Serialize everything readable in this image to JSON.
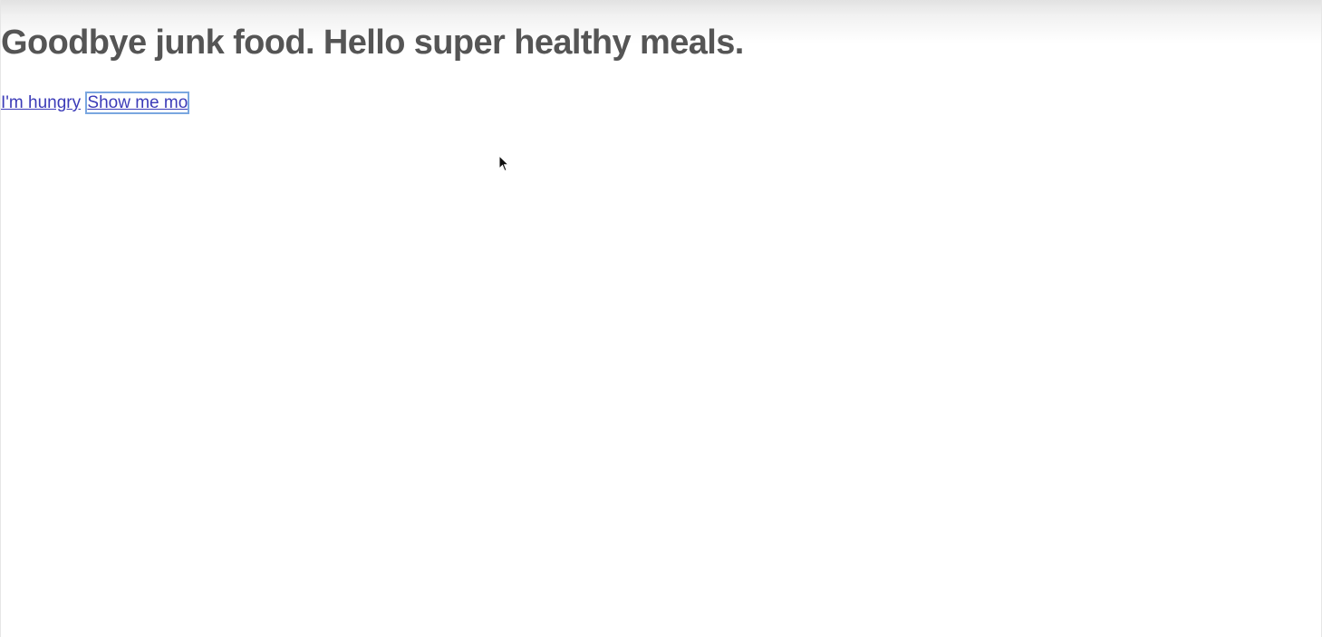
{
  "header": {
    "title": "Goodbye junk food. Hello super healthy meals."
  },
  "actions": {
    "hungry_label": "I'm hungry",
    "show_more_label": "Show me mo"
  },
  "cursor": {
    "icon": "arrow-cursor-icon"
  },
  "colors": {
    "title": "#555555",
    "link": "#3b3bb8",
    "focus_ring": "#7aa7e0"
  }
}
